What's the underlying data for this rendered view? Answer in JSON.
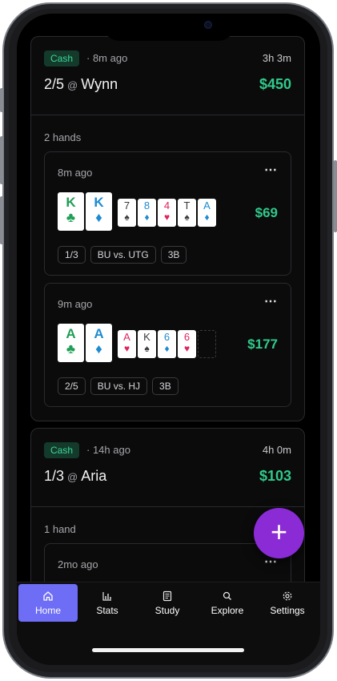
{
  "sessions": [
    {
      "badge": "Cash",
      "ago": "· 8m ago",
      "duration": "3h 3m",
      "stakes": "2/5",
      "at": "@",
      "venue": "Wynn",
      "profit": "$450",
      "hands_count": "2 hands",
      "hands": [
        {
          "ago": "8m ago",
          "amount": "$69",
          "hole_cards": [
            {
              "rank": "K",
              "suit": "♣",
              "suit_name": "clubs"
            },
            {
              "rank": "K",
              "suit": "♦",
              "suit_name": "diamonds"
            }
          ],
          "board": [
            {
              "rank": "7",
              "suit": "♠",
              "suit_name": "spades"
            },
            {
              "rank": "8",
              "suit": "♦",
              "suit_name": "diamonds"
            },
            {
              "rank": "4",
              "suit": "♥",
              "suit_name": "hearts"
            },
            {
              "rank": "T",
              "suit": "♠",
              "suit_name": "spades"
            },
            {
              "rank": "A",
              "suit": "♦",
              "suit_name": "diamonds"
            }
          ],
          "tags": [
            "1/3",
            "BU vs. UTG",
            "3B"
          ]
        },
        {
          "ago": "9m ago",
          "amount": "$177",
          "hole_cards": [
            {
              "rank": "A",
              "suit": "♣",
              "suit_name": "clubs"
            },
            {
              "rank": "A",
              "suit": "♦",
              "suit_name": "diamonds"
            }
          ],
          "board": [
            {
              "rank": "A",
              "suit": "♥",
              "suit_name": "hearts"
            },
            {
              "rank": "K",
              "suit": "♠",
              "suit_name": "spades"
            },
            {
              "rank": "6",
              "suit": "♦",
              "suit_name": "diamonds"
            },
            {
              "rank": "6",
              "suit": "♥",
              "suit_name": "hearts"
            }
          ],
          "tags": [
            "2/5",
            "BU vs. HJ",
            "3B"
          ]
        }
      ]
    },
    {
      "badge": "Cash",
      "ago": "· 14h ago",
      "duration": "4h 0m",
      "stakes": "1/3",
      "at": "@",
      "venue": "Aria",
      "profit": "$103",
      "hands_count": "1 hand",
      "hands": [
        {
          "ago": "2mo ago"
        }
      ]
    }
  ],
  "more_icon": "⋯",
  "fab": {
    "icon": "plus-icon",
    "label": "+"
  },
  "tabbar": {
    "active": "Home",
    "items": [
      {
        "label": "Home",
        "icon": "home-icon"
      },
      {
        "label": "Stats",
        "icon": "bar-chart-icon"
      },
      {
        "label": "Study",
        "icon": "book-icon"
      },
      {
        "label": "Explore",
        "icon": "search-icon"
      },
      {
        "label": "Settings",
        "icon": "gear-icon"
      }
    ]
  },
  "colors": {
    "profit": "#30c98a",
    "badge_bg": "#133a2b",
    "badge_text": "#3dd69a",
    "fab": "#8a2bd6",
    "tab_active": "#6e6df5"
  }
}
